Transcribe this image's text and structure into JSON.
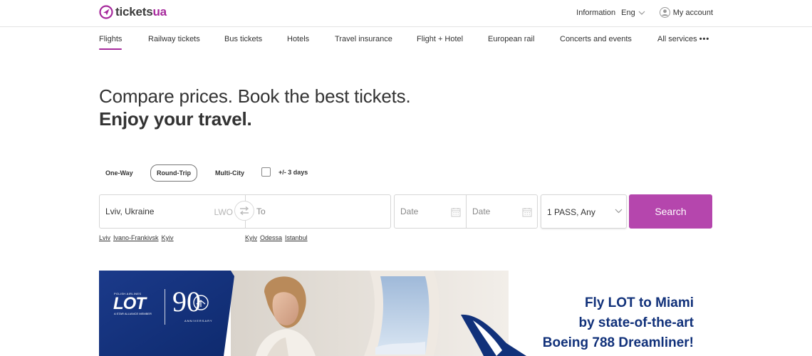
{
  "header": {
    "logo": {
      "brand": "tickets",
      "brand_suffix": "ua"
    },
    "information_label": "Information",
    "language_label": "Eng",
    "account_label": "My account"
  },
  "nav": {
    "items": [
      {
        "label": "Flights",
        "active": true
      },
      {
        "label": "Railway tickets"
      },
      {
        "label": "Bus tickets"
      },
      {
        "label": "Hotels"
      },
      {
        "label": "Travel insurance"
      },
      {
        "label": "Flight + Hotel"
      },
      {
        "label": "European rail"
      },
      {
        "label": "Concerts and events"
      },
      {
        "label": "All services"
      }
    ],
    "more_dots": "•••"
  },
  "hero": {
    "line1": "Compare prices. Book the best tickets.",
    "line2": "Enjoy your travel."
  },
  "search": {
    "trip_types": [
      {
        "label": "One-Way"
      },
      {
        "label": "Round-Trip",
        "selected": true
      },
      {
        "label": "Multi-City"
      }
    ],
    "flex_dates_label": "+/- 3 days",
    "flex_dates_checked": false,
    "from_value": "Lviv, Ukraine",
    "from_code": "LWO",
    "to_placeholder": "To",
    "depart_placeholder": "Date",
    "return_placeholder": "Date",
    "passengers": "1 PASS, Any",
    "search_label": "Search",
    "quick_from": [
      "Lviv",
      "Ivano-Frankivsk",
      "Kyiv"
    ],
    "quick_to": [
      "Kyiv",
      "Odessa",
      "Istanbul"
    ]
  },
  "banner": {
    "line1": "Fly LOT to Miami",
    "line2": "by state-of-the-art",
    "line3": "Boeing 788 Dreamliner!",
    "logo_word": "LOT",
    "logo_small": "POLISH AIRLINES",
    "logo_sub": "A STAR ALLIANCE MEMBER",
    "anniversary_number": "90",
    "anniversary_word": "ANNIVERSARY"
  },
  "colors": {
    "brand": "#a6299c",
    "search_button": "#b546ad",
    "banner_navy": "#11317a"
  },
  "icons": [
    "logo-icon",
    "chevron-down-icon",
    "user-icon",
    "swap-icon",
    "calendar-icon",
    "lot-crane-icon"
  ]
}
